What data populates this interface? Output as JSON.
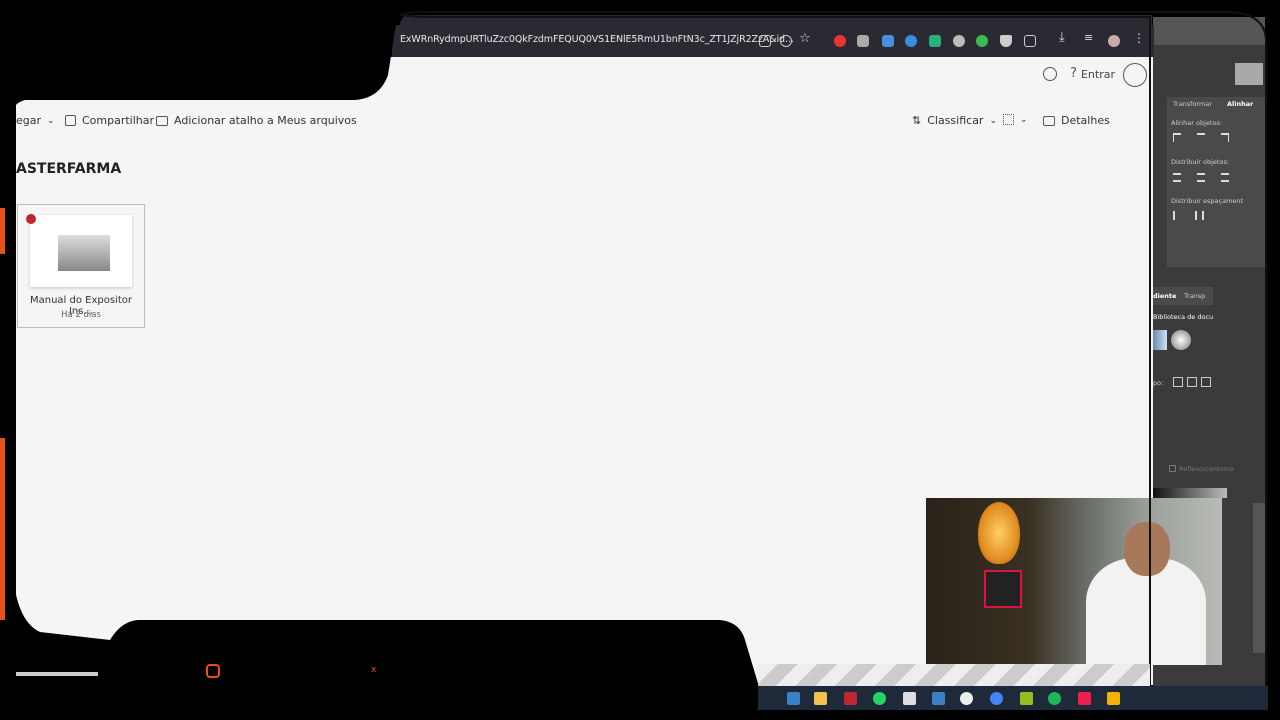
{
  "browser": {
    "url": "ExWRnRydmpURTluZzc0QkFzdmFEQUQ0VS1ENlE5RmU1bnFtN3c_ZT1JZjR2ZzA&id...",
    "header": {
      "signin_label": "Entrar"
    }
  },
  "toolbar": {
    "navigate_label": "egar",
    "share_label": "Compartilhar",
    "add_shortcut_label": "Adicionar atalho a Meus arquivos",
    "sort_label": "Classificar",
    "details_label": "Detalhes"
  },
  "folder": {
    "title": "ASTERFARMA"
  },
  "files": [
    {
      "name": "Manual do Expositor Ins...",
      "modified": "Há 2 dias"
    }
  ],
  "right_panel": {
    "tabs": [
      "Transformar",
      "Alinhar"
    ],
    "align_objects": "Alinhar objetos:",
    "distribute_objects": "Distribuir objetos:",
    "distribute_spacing": "Distribuir espaçament",
    "gradient_tab": "diente",
    "transparency_tab": "Transp",
    "doc_library": "Biblioteca de docu",
    "type_label": "po:",
    "option_label": "Reflexo/contorno"
  },
  "overlay": {
    "social_x": "x"
  },
  "colors": {
    "accent": "#e8501f",
    "browser_bar": "#2b2a33",
    "page_bg": "#f5f5f5"
  }
}
